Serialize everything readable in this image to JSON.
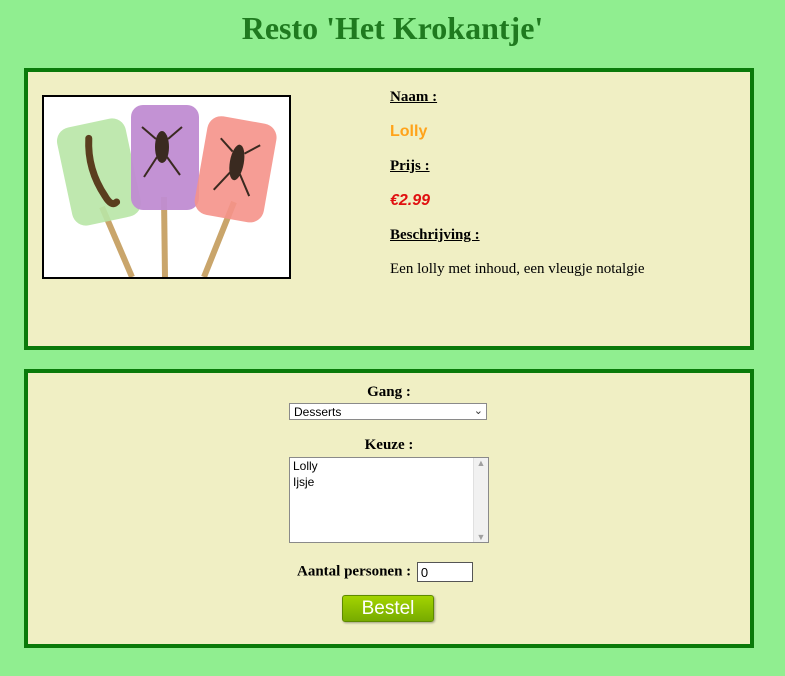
{
  "page": {
    "title": "Resto 'Het Krokantje'"
  },
  "product": {
    "name_label": "Naam :",
    "name": "Lolly",
    "price_label": "Prijs :",
    "price": "€2.99",
    "description_label": "Beschrijving :",
    "description": "Een lolly met inhoud, een vleugje notalgie",
    "colors": {
      "name": "#ffa31a",
      "price": "#e01010"
    }
  },
  "order": {
    "course_label": "Gang :",
    "course_selected": "Desserts",
    "choice_label": "Keuze :",
    "choices": [
      "Lolly",
      "Ijsje"
    ],
    "persons_label": "Aantal personen :",
    "persons_value": "0",
    "submit_label": "Bestel"
  },
  "colors": {
    "background": "#90ee90",
    "panel": "#f0efc4",
    "border": "#0a7a0a",
    "title": "#1f7a1f",
    "button": "#8cc400"
  }
}
